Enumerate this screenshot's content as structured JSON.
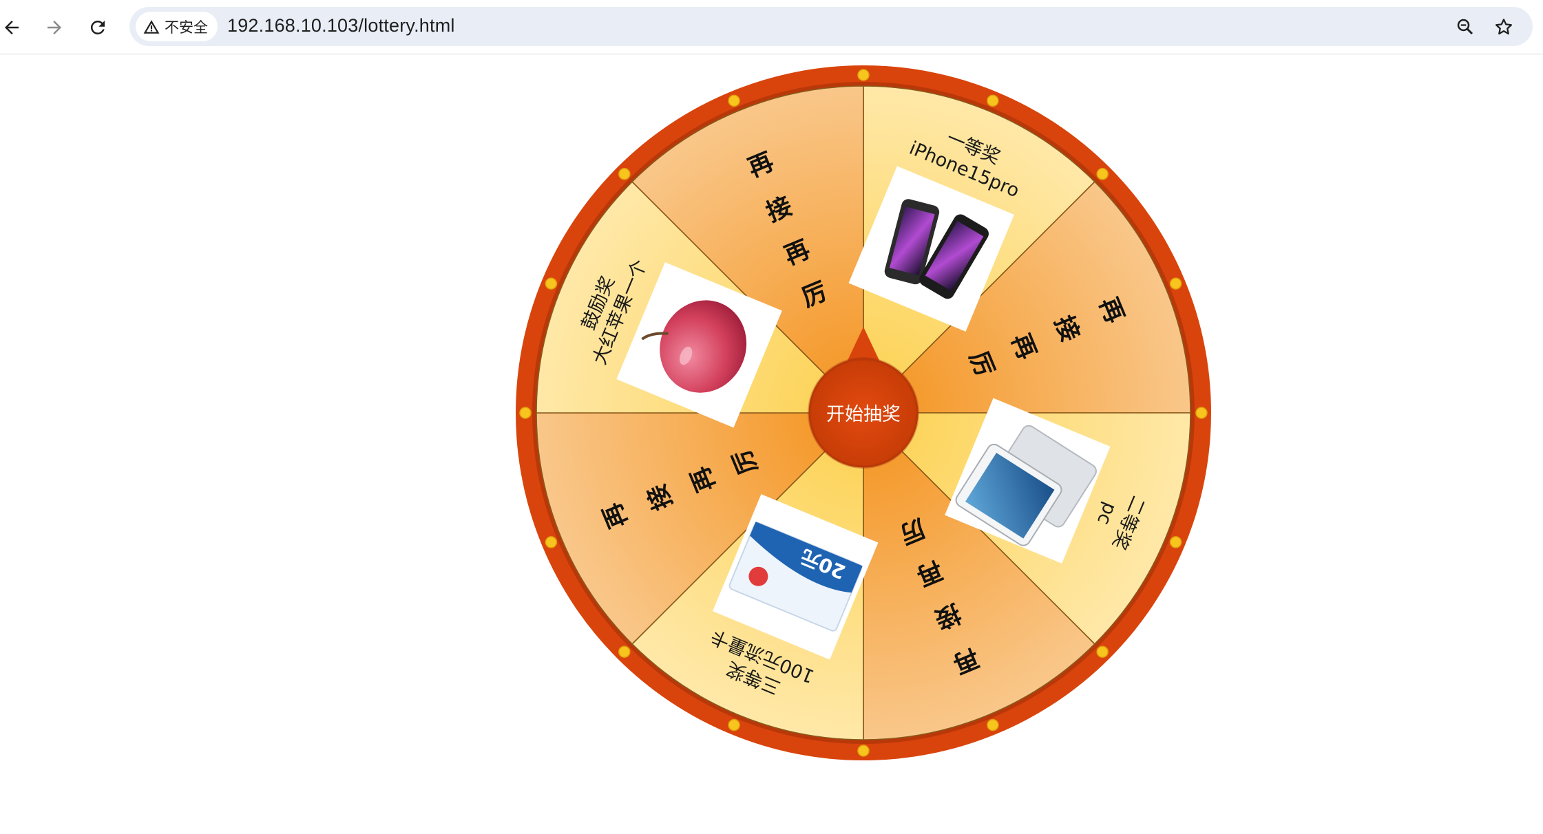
{
  "browser": {
    "security_label": "不安全",
    "url": "192.168.10.103/lottery.html",
    "icons": {
      "back": "arrow-left-icon",
      "forward": "arrow-right-icon",
      "reload": "reload-icon",
      "warning": "warning-triangle-icon",
      "zoom": "zoom-icon",
      "bookmark": "star-icon"
    }
  },
  "wheel": {
    "center_button_label": "开始抽奖",
    "colors": {
      "rim": "#d9440c",
      "rim_inner": "#c83a08",
      "light": "#ffe6a8",
      "dark": "#f5a44a",
      "dot": "#f7c51d",
      "center": "#d9440c"
    },
    "sectors": [
      {
        "type": "prize",
        "prize": "一等奖",
        "item": "iPhone15pro",
        "image": "iphone-image"
      },
      {
        "type": "retry",
        "chars": [
          "再",
          "接",
          "再",
          "厉"
        ]
      },
      {
        "type": "prize",
        "prize": "二等奖",
        "item": "pc",
        "image": "ipad-image"
      },
      {
        "type": "retry",
        "chars": [
          "再",
          "接",
          "再",
          "厉"
        ]
      },
      {
        "type": "prize",
        "prize": "三等奖",
        "item": "100元流量卡",
        "image": "data-card-image",
        "image_text": "20元"
      },
      {
        "type": "retry",
        "chars": [
          "再",
          "接",
          "再",
          "厉"
        ]
      },
      {
        "type": "prize",
        "prize": "鼓励奖",
        "item": "大红苹果一个",
        "image": "apple-image"
      },
      {
        "type": "retry",
        "chars": [
          "再",
          "接",
          "再",
          "厉"
        ]
      }
    ]
  }
}
